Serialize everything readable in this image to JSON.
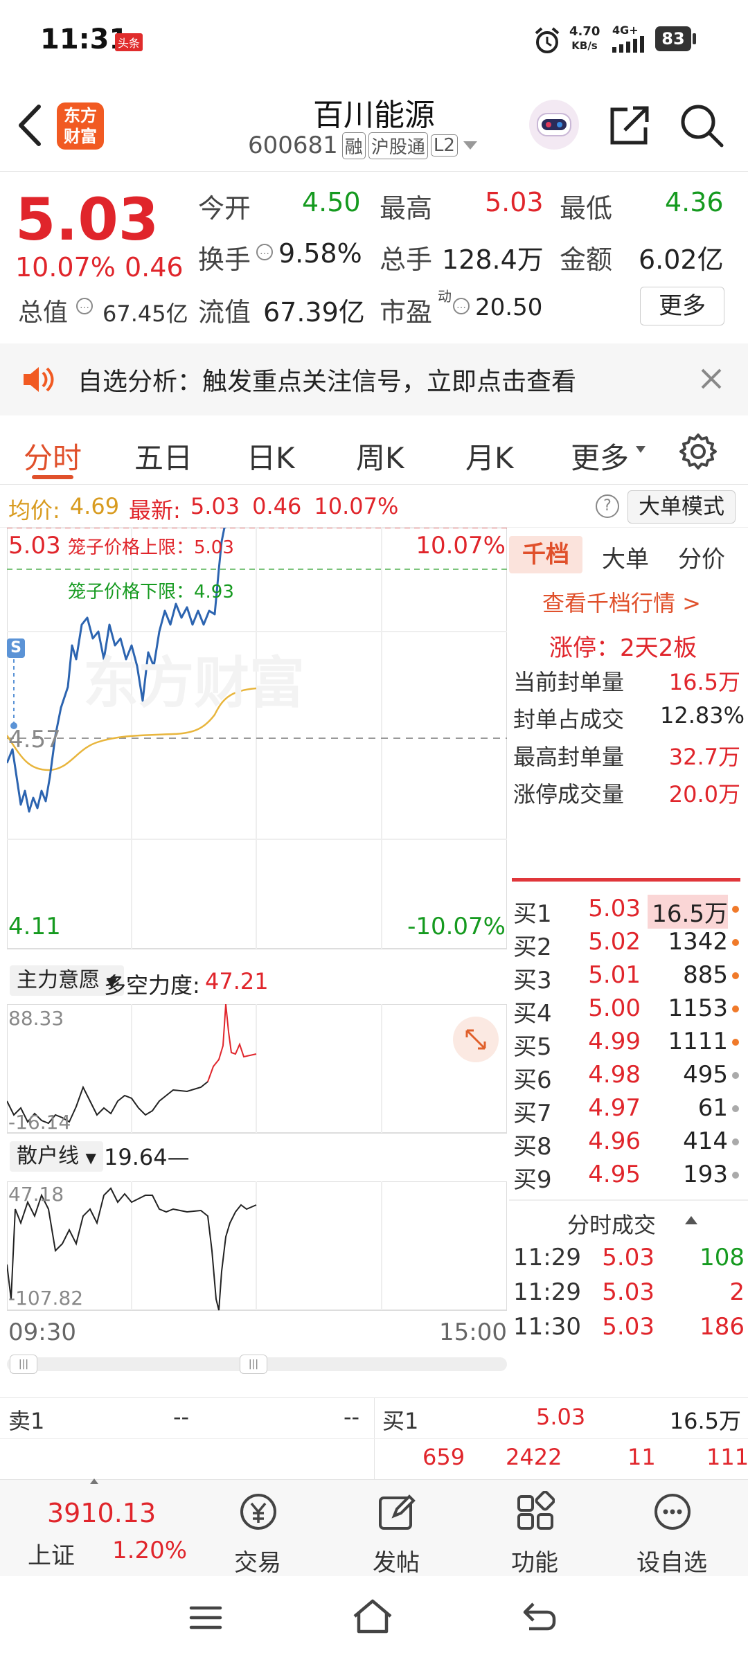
{
  "status": {
    "time": "11:31",
    "badge": "头条",
    "net_speed": "4.70",
    "net_unit": "KB/s",
    "signal": "4G+",
    "battery": "83"
  },
  "nav": {
    "logo_text_1": "东方",
    "logo_text_2": "财富",
    "stock_name": "百川能源",
    "code": "600681",
    "tags": [
      "融",
      "沪股通",
      "L2"
    ]
  },
  "quote": {
    "price": "5.03",
    "change_pct": "10.07%",
    "change": "0.46",
    "open_label": "今开",
    "open": "4.50",
    "high_label": "最高",
    "high": "5.03",
    "low_label": "最低",
    "low": "4.36",
    "turnover_label": "换手",
    "turnover": "9.58%",
    "volume_label": "总手",
    "volume": "128.4万",
    "amount_label": "金额",
    "amount": "6.02亿",
    "mktcap_label": "总值",
    "mktcap": "67.45亿",
    "float_label": "流值",
    "float_cap": "67.39亿",
    "pe_label": "市盈",
    "pe_sup": "动",
    "pe": "20.50",
    "more_label": "更多"
  },
  "alert": {
    "text": "自选分析：触发重点关注信号，立即点击查看"
  },
  "tabs": [
    "分时",
    "五日",
    "日K",
    "周K",
    "月K",
    "更多"
  ],
  "info": {
    "avg_label": "均价:",
    "avg": "4.69",
    "latest_label": "最新:",
    "latest": "5.03",
    "change": "0.46",
    "change_pct": "10.07%",
    "mode_label": "大单模式"
  },
  "chart": {
    "top_price": "5.03",
    "top_pct": "10.07%",
    "bottom_price": "4.11",
    "bottom_pct": "-10.07%",
    "mid_price": "4.57",
    "cage_upper": "笼子价格上限：5.03",
    "cage_lower": "笼子价格下限：4.93",
    "s_marker": "S",
    "watermark": "东方财富",
    "ind1_label": "主力意愿",
    "ind1_name": "多空力度:",
    "ind1_value": "47.21",
    "ind1_max": "88.33",
    "ind1_min": "-16.14",
    "ind2_label": "散户线",
    "ind2_value": "19.64—",
    "ind2_max": "47.18",
    "ind2_min": "-107.82",
    "time_start": "09:30",
    "time_end": "15:00"
  },
  "right": {
    "tabs": [
      "千档",
      "大单",
      "分价"
    ],
    "link": "查看千档行情 >",
    "limit_title": "涨停：2天2板",
    "stats": [
      {
        "label": "当前封单量",
        "value": "16.5万"
      },
      {
        "label": "封单占成交",
        "value": "12.83%"
      },
      {
        "label": "最高封单量",
        "value": "32.7万"
      },
      {
        "label": "涨停成交量",
        "value": "20.0万"
      }
    ],
    "bids": [
      {
        "label": "买1",
        "price": "5.03",
        "vol": "16.5万"
      },
      {
        "label": "买2",
        "price": "5.02",
        "vol": "1342"
      },
      {
        "label": "买3",
        "price": "5.01",
        "vol": "885"
      },
      {
        "label": "买4",
        "price": "5.00",
        "vol": "1153"
      },
      {
        "label": "买5",
        "price": "4.99",
        "vol": "1111"
      },
      {
        "label": "买6",
        "price": "4.98",
        "vol": "495"
      },
      {
        "label": "买7",
        "price": "4.97",
        "vol": "61"
      },
      {
        "label": "买8",
        "price": "4.96",
        "vol": "414"
      },
      {
        "label": "买9",
        "price": "4.95",
        "vol": "193"
      }
    ],
    "trades_title": "分时成交",
    "trades": [
      {
        "time": "11:29",
        "price": "5.03",
        "vol": "108"
      },
      {
        "time": "11:29",
        "price": "5.03",
        "vol": "2"
      },
      {
        "time": "11:30",
        "price": "5.03",
        "vol": "186"
      }
    ]
  },
  "book": {
    "sell_label": "卖1",
    "sell_price": "--",
    "sell_vol": "--",
    "buy_label": "买1",
    "buy_price": "5.03",
    "buy_vol": "16.5万",
    "row2": [
      "659",
      "2422",
      "11",
      "111"
    ]
  },
  "bottom": {
    "index_value": "3910.13",
    "index_name": "上证",
    "index_pct": "1.20%",
    "items": [
      "交易",
      "发帖",
      "功能",
      "设自选"
    ]
  }
}
